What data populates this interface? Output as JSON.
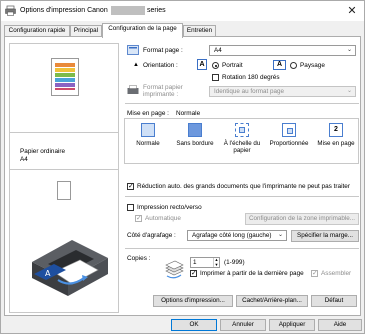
{
  "window": {
    "title_prefix": "Options d'impression Canon",
    "title_suffix": "series",
    "close_glyph": "✕"
  },
  "tabs": [
    {
      "label": "Configuration rapide"
    },
    {
      "label": "Principal"
    },
    {
      "label": "Configuration de la page"
    },
    {
      "label": "Entretien"
    }
  ],
  "preview": {
    "media_type": "Papier ordinaire",
    "page_size": "A4"
  },
  "page_setup": {
    "format_label": "Format page :",
    "format_value": "A4",
    "orientation_label": "Orientation :",
    "portrait_label": "Portrait",
    "landscape_label": "Paysage",
    "orientation_selected": "Portrait",
    "rotate_label": "Rotation 180 degrés",
    "printer_paper_label": "Format papier imprimante :",
    "printer_paper_value": "Identique au format page"
  },
  "layout": {
    "label": "Mise en page :",
    "current": "Normale",
    "options": [
      {
        "label": "Normale"
      },
      {
        "label": "Sans bordure"
      },
      {
        "label": "À l'échelle du papier"
      },
      {
        "label": "Proportionnée"
      },
      {
        "label": "Mise en page"
      }
    ],
    "auto_reduce_label": "Réduction auto. des grands documents que l'imprimante ne peut pas traiter",
    "auto_reduce_checked": true
  },
  "duplex": {
    "label": "Impression recto/verso",
    "checked": false,
    "automatic_label": "Automatique",
    "automatic_checked": true,
    "config_button": "Configuration de la zone imprimable..."
  },
  "stapling": {
    "label": "Côté d'agrafage :",
    "value": "Agrafage côté long (gauche)",
    "margin_button": "Spécifier la marge..."
  },
  "copies": {
    "label": "Copies :",
    "value": "1",
    "range": "(1-999)",
    "reverse_label": "Imprimer à partir de la dernière page",
    "reverse_checked": true,
    "collate_label": "Assembler",
    "collate_checked": true
  },
  "bottom_buttons": {
    "print_options": "Options d'impression...",
    "stamp_background": "Cachet/Arrière-plan...",
    "defaults": "Défaut"
  },
  "footer": {
    "ok": "OK",
    "cancel": "Annuler",
    "apply": "Appliquer",
    "help": "Aide"
  },
  "colors": {
    "accent": "#0078d7",
    "icon_blue": "#4a7ecf"
  }
}
